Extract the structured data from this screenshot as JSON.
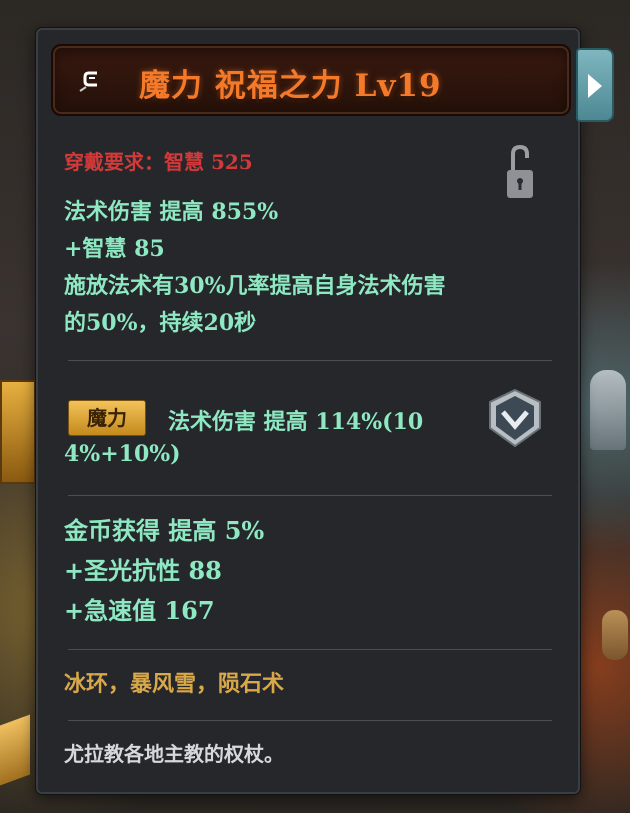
{
  "item": {
    "title": "魔力 祝福之力 Lv19",
    "requirement": "穿戴要求：智慧 525",
    "base_stats": [
      "法术伤害  提高  855%",
      "+智慧  85",
      "施放法术有30%几率提高自身法术伤害",
      "的50%，持续20秒"
    ],
    "enchant": {
      "badge": "魔力",
      "line1": "法术伤害  提高  114%(10",
      "line2": "4%+10%)"
    },
    "extra_stats": [
      "金币获得  提高  5%",
      "+圣光抗性  88",
      "+急速值  167"
    ],
    "skills": "冰环，暴风雪，陨石术",
    "description": "尤拉教各地主教的权杖。"
  },
  "icons": {
    "item": "hook-icon",
    "lock": "padlock-icon",
    "shield": "shield-icon",
    "expand": "chevron-right-icon"
  },
  "colors": {
    "title": "#f47a2a",
    "requirement": "#d23a3a",
    "stat_green": "#8ee8c2",
    "skill_gold": "#d9a84a",
    "badge": "#e0a530",
    "panel_bg": "#25272b"
  }
}
